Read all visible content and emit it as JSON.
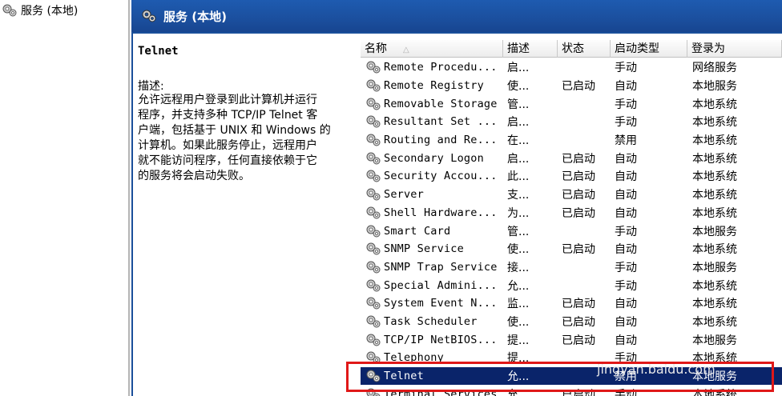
{
  "tree": {
    "root_label": "服务 (本地)"
  },
  "header": {
    "title": "服务 (本地)"
  },
  "description": {
    "service_name": "Telnet",
    "label": "描述:",
    "lines": [
      "允许远程用户登录到此计算机并运行",
      "程序，并支持多种 TCP/IP Telnet 客",
      "户端，包括基于 UNIX 和 Windows 的",
      "计算机。如果此服务停止，远程用户",
      "就不能访问程序，任何直接依赖于它",
      "的服务将会启动失败。"
    ]
  },
  "columns": {
    "name": "名称",
    "desc": "描述",
    "status": "状态",
    "startup": "启动类型",
    "logon": "登录为",
    "sort_indicator": "△"
  },
  "services": [
    {
      "name": "Remote Procedu...",
      "desc": "启...",
      "status": "",
      "startup": "手动",
      "logon": "网络服务"
    },
    {
      "name": "Remote Registry",
      "desc": "使...",
      "status": "已启动",
      "startup": "自动",
      "logon": "本地服务"
    },
    {
      "name": "Removable Storage",
      "desc": "管...",
      "status": "",
      "startup": "手动",
      "logon": "本地系统"
    },
    {
      "name": "Resultant Set ...",
      "desc": "启...",
      "status": "",
      "startup": "手动",
      "logon": "本地系统"
    },
    {
      "name": "Routing and Re...",
      "desc": "在...",
      "status": "",
      "startup": "禁用",
      "logon": "本地系统"
    },
    {
      "name": "Secondary Logon",
      "desc": "启...",
      "status": "已启动",
      "startup": "自动",
      "logon": "本地系统"
    },
    {
      "name": "Security Accou...",
      "desc": "此...",
      "status": "已启动",
      "startup": "自动",
      "logon": "本地系统"
    },
    {
      "name": "Server",
      "desc": "支...",
      "status": "已启动",
      "startup": "自动",
      "logon": "本地系统"
    },
    {
      "name": "Shell Hardware...",
      "desc": "为...",
      "status": "已启动",
      "startup": "自动",
      "logon": "本地系统"
    },
    {
      "name": "Smart Card",
      "desc": "管...",
      "status": "",
      "startup": "手动",
      "logon": "本地服务"
    },
    {
      "name": "SNMP Service",
      "desc": "使...",
      "status": "已启动",
      "startup": "自动",
      "logon": "本地系统"
    },
    {
      "name": "SNMP Trap Service",
      "desc": "接...",
      "status": "",
      "startup": "手动",
      "logon": "本地服务"
    },
    {
      "name": "Special Admini...",
      "desc": "允...",
      "status": "",
      "startup": "手动",
      "logon": "本地系统"
    },
    {
      "name": "System Event N...",
      "desc": "监...",
      "status": "已启动",
      "startup": "自动",
      "logon": "本地系统"
    },
    {
      "name": "Task Scheduler",
      "desc": "使...",
      "status": "已启动",
      "startup": "自动",
      "logon": "本地系统"
    },
    {
      "name": "TCP/IP NetBIOS...",
      "desc": "提...",
      "status": "已启动",
      "startup": "自动",
      "logon": "本地服务"
    },
    {
      "name": "Telephony",
      "desc": "提...",
      "status": "",
      "startup": "手动",
      "logon": "本地系统"
    },
    {
      "name": "Telnet",
      "desc": "允...",
      "status": "",
      "startup": "禁用",
      "logon": "本地服务",
      "selected": true
    },
    {
      "name": "Terminal Services",
      "desc": "允...",
      "status": "已启动",
      "startup": "手动",
      "logon": "本地系统"
    }
  ],
  "watermark": {
    "text": "jingyan.baidu.com"
  },
  "colors": {
    "header_blue": "#1b4f9e",
    "selected_row": "#0a246a",
    "highlight_red": "#e01818"
  }
}
